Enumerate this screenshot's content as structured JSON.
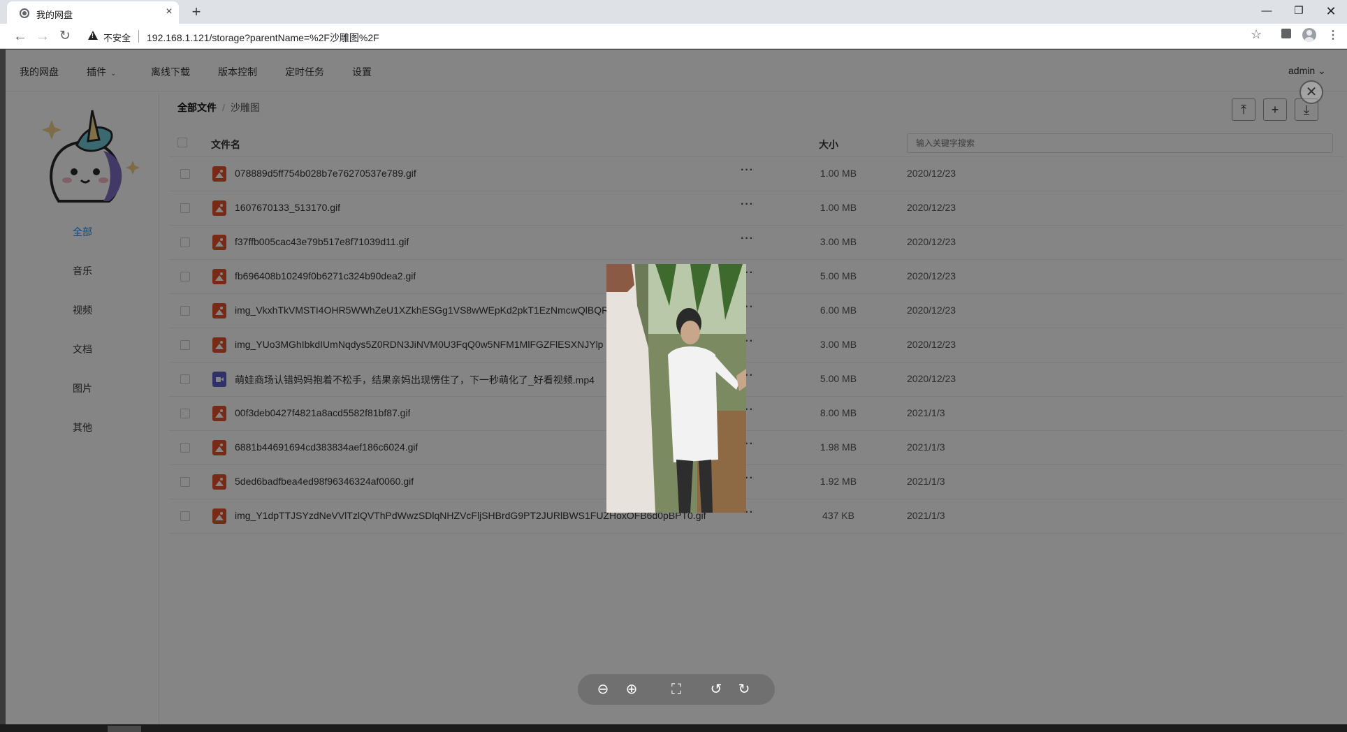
{
  "browser": {
    "tab_title": "我的网盘",
    "tab_close": "×",
    "new_tab": "+",
    "insecure_label": "不安全",
    "url": "192.168.1.121/storage?parentName=%2F沙雕图%2F",
    "window_controls": {
      "minimize": "—",
      "maximize": "❐",
      "close": "✕"
    },
    "nav": {
      "back": "←",
      "forward": "→",
      "reload": "↻"
    },
    "star": "☆",
    "menu": "⋮"
  },
  "topnav": {
    "items": [
      "我的网盘",
      "插件",
      "离线下载",
      "版本控制",
      "定时任务",
      "设置"
    ],
    "caret": "⌄",
    "user": "admin ⌄"
  },
  "sidebar": {
    "items": [
      "全部",
      "音乐",
      "视频",
      "文档",
      "图片",
      "其他"
    ],
    "active_index": 0
  },
  "breadcrumb": {
    "root": "全部文件",
    "separator": "/",
    "current": "沙雕图"
  },
  "actions": {
    "upload": "⤒",
    "add": "+",
    "download": "⤓"
  },
  "table": {
    "col_name": "文件名",
    "col_size": "大小",
    "search_placeholder": "输入关键字搜索",
    "more": "···",
    "rows": [
      {
        "name": "078889d5ff754b028b7e76270537e789.gif",
        "size": "1.00 MB",
        "date": "2020/12/23",
        "type": "image"
      },
      {
        "name": "1607670133_513170.gif",
        "size": "1.00 MB",
        "date": "2020/12/23",
        "type": "image"
      },
      {
        "name": "f37ffb005cac43e79b517e8f71039d11.gif",
        "size": "3.00 MB",
        "date": "2020/12/23",
        "type": "image"
      },
      {
        "name": "fb696408b10249f0b6271c324b90dea2.gif",
        "size": "5.00 MB",
        "date": "2020/12/23",
        "type": "image"
      },
      {
        "name": "img_VkxhTkVMSTI4OHR5WWhZeU1XZkhESGg1VS8wWEpKd2pkT1EzNmcwQlBQR",
        "size": "6.00 MB",
        "date": "2020/12/23",
        "type": "image"
      },
      {
        "name": "img_YUo3MGhIbkdIUmNqdys5Z0RDN3JiNVM0U3FqQ0w5NFM1MlFGZFlESXNJYlp",
        "size": "3.00 MB",
        "date": "2020/12/23",
        "type": "image"
      },
      {
        "name": "萌娃商场认错妈妈抱着不松手，结果亲妈出现愣住了，下一秒萌化了_好看视频.mp4",
        "size": "5.00 MB",
        "date": "2020/12/23",
        "type": "video"
      },
      {
        "name": "00f3deb0427f4821a8acd5582f81bf87.gif",
        "size": "8.00 MB",
        "date": "2021/1/3",
        "type": "image"
      },
      {
        "name": "6881b44691694cd383834aef186c6024.gif",
        "size": "1.98 MB",
        "date": "2021/1/3",
        "type": "image"
      },
      {
        "name": "5ded6badfbea4ed98f96346324af0060.gif",
        "size": "1.92 MB",
        "date": "2021/1/3",
        "type": "image"
      },
      {
        "name": "img_Y1dpTTJSYzdNeVVlTzlQVThPdWwzSDlqNHZVcFljSHBrdG9PT2JURlBWS1FUZHoxOFB6d0pBPT0.gif",
        "size": "437 KB",
        "date": "2021/1/3",
        "type": "image"
      }
    ]
  },
  "viewer": {
    "close": "✕",
    "tools": [
      "⊖",
      "⊕",
      "⛶",
      "↺",
      "↻"
    ]
  },
  "colors": {
    "accent": "#1890ff",
    "image_icon": "#e5532d",
    "video_icon": "#5b5fc7",
    "overlay": "rgba(0,0,0,0.48)"
  }
}
